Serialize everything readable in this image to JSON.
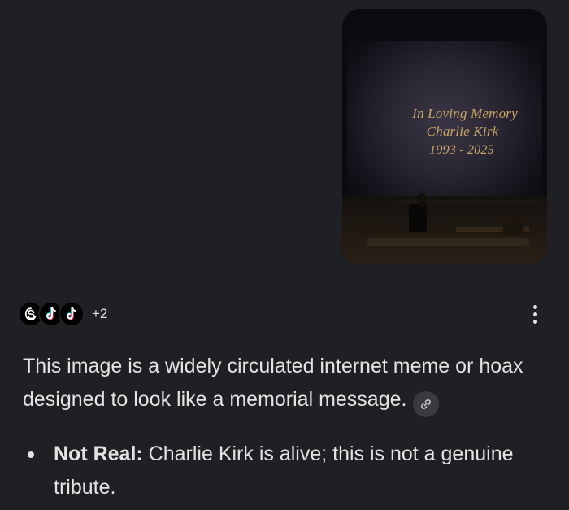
{
  "image": {
    "memorial_line1": "In Loving Memory",
    "memorial_line2": "Charlie Kirk",
    "memorial_line3": "1993 - 2025",
    "text_color": "#c8a764"
  },
  "sources": {
    "icons": [
      "threads-icon",
      "tiktok-icon",
      "tiktok-icon"
    ],
    "more_count": "+2"
  },
  "answer": {
    "text": "This image is a widely circulated internet meme or hoax designed to look like a memorial message."
  },
  "bullets": [
    {
      "label": "Not Real:",
      "text": " Charlie Kirk is alive; this is not a genuine tribute."
    }
  ],
  "colors": {
    "background": "#1f2023",
    "text": "#e3e3e3",
    "chip": "#3a3b3f"
  }
}
